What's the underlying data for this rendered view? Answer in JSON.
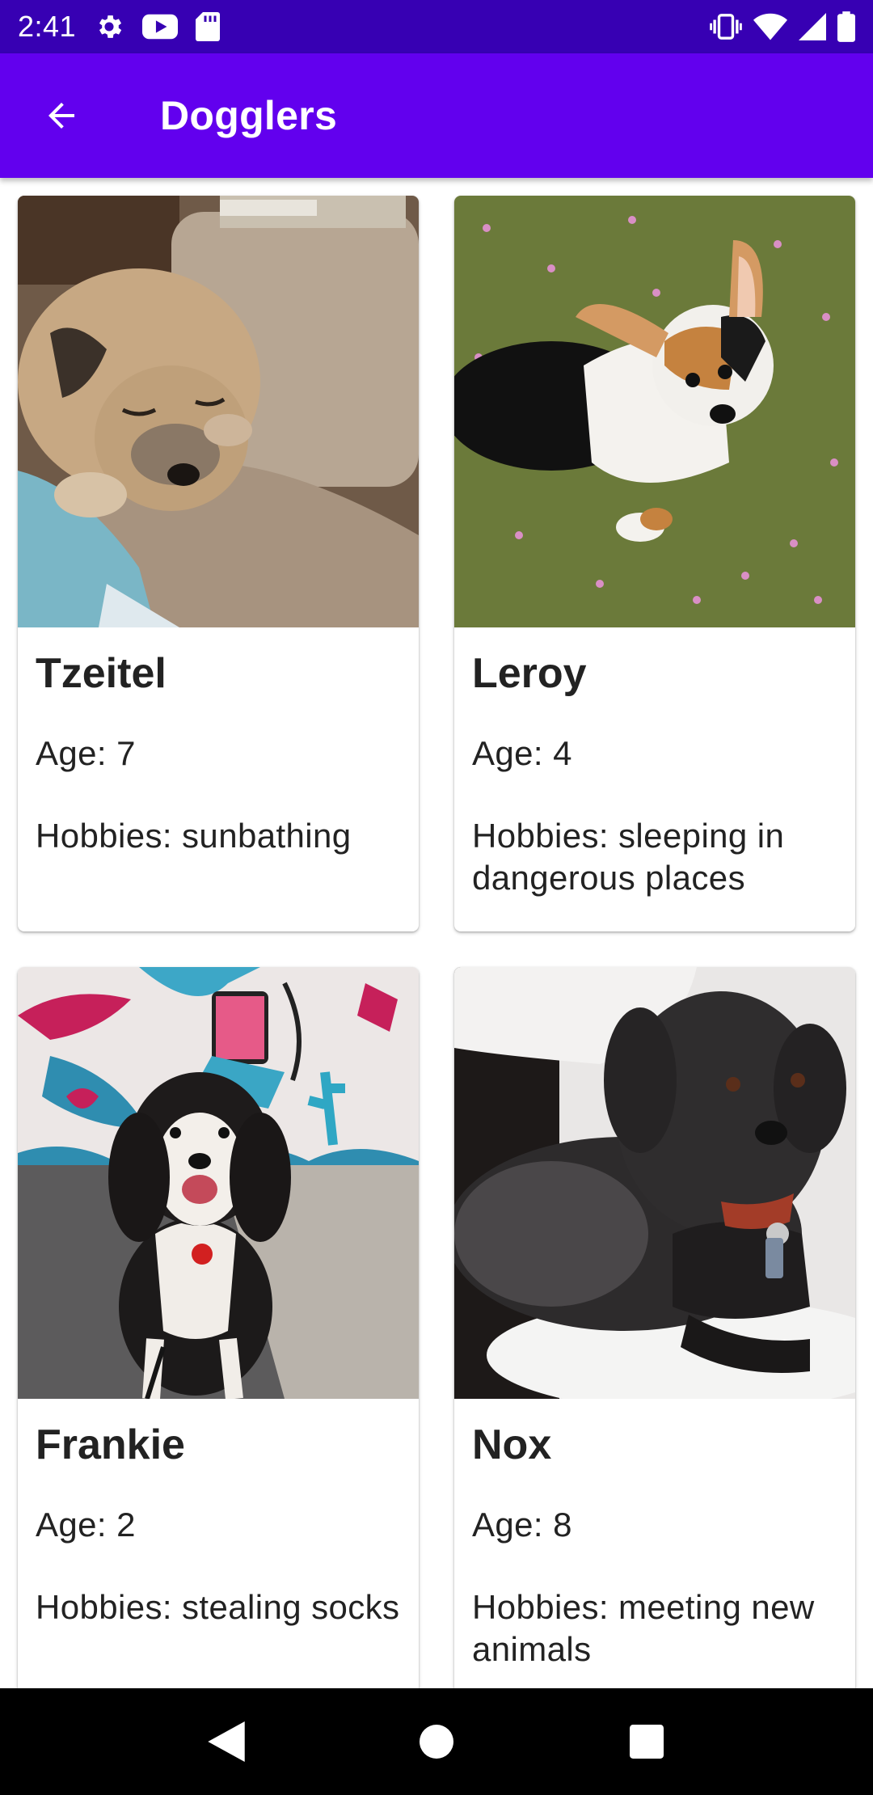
{
  "status_bar": {
    "time": "2:41",
    "left_icons": [
      "settings-icon",
      "youtube-icon",
      "sd-card-icon"
    ],
    "right_icons": [
      "vibrate-icon",
      "wifi-icon",
      "signal-icon",
      "battery-icon"
    ]
  },
  "app_bar": {
    "title": "Dogglers",
    "back_icon": "arrow-back-icon",
    "background": "#6200ee",
    "status_background": "#3700b3"
  },
  "dogs": [
    {
      "name": "Tzeitel",
      "age": "Age: 7",
      "hobbies": "Hobbies: sunbathing",
      "photo": "pug-on-couch"
    },
    {
      "name": "Leroy",
      "age": "Age: 4",
      "hobbies": "Hobbies: sleeping in dangerous places",
      "photo": "corgi-on-grass"
    },
    {
      "name": "Frankie",
      "age": "Age: 2",
      "hobbies": "Hobbies: stealing socks",
      "photo": "bernedoodle-mural"
    },
    {
      "name": "Nox",
      "age": "Age: 8",
      "hobbies": "Hobbies: meeting new animals",
      "photo": "black-terrier-bed"
    }
  ],
  "nav_bar": {
    "back_icon": "nav-back-icon",
    "home_icon": "nav-home-icon",
    "recents_icon": "nav-recents-icon"
  }
}
